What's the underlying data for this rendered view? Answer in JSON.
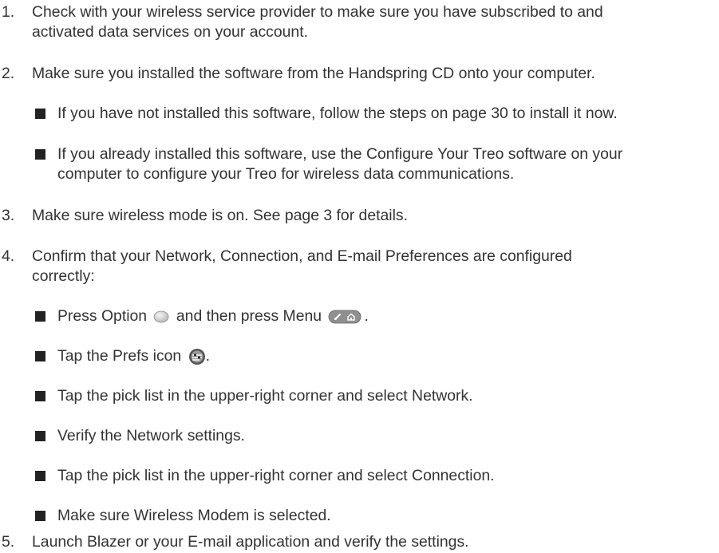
{
  "items": [
    {
      "num": "1.",
      "lines": [
        "Check with your wireless service provider to make sure you have subscribed to and",
        "activated data services on your account."
      ]
    },
    {
      "num": "2.",
      "lines": [
        "Make sure you installed the software from the Handspring CD onto your computer."
      ]
    },
    {
      "bullet": true,
      "lines": [
        "If you have not installed this software, follow the steps on page 30 to install it now."
      ]
    },
    {
      "bullet": true,
      "lines": [
        "If you already installed this software, use the Configure Your Treo software on your",
        "computer to configure your Treo for wireless data communications."
      ]
    },
    {
      "num": "3.",
      "lines": [
        "Make sure wireless mode is on. See page 3 for details."
      ]
    },
    {
      "num": "4.",
      "lines": [
        "Confirm that your Network, Connection, and E-mail Preferences are configured",
        "correctly:"
      ]
    },
    {
      "bullet": true,
      "parts": [
        "Press Option",
        "and then press Menu",
        "."
      ]
    },
    {
      "bullet": true,
      "parts": [
        "Tap the Prefs icon",
        "."
      ]
    },
    {
      "bullet": true,
      "lines": [
        "Tap the pick list in the upper-right corner and select Network."
      ]
    },
    {
      "bullet": true,
      "lines": [
        "Verify the Network settings."
      ]
    },
    {
      "bullet": true,
      "lines": [
        "Tap the pick list in the upper-right corner and select Connection."
      ]
    },
    {
      "bullet": true,
      "lines": [
        "Make sure Wireless Modem is selected."
      ]
    },
    {
      "num": "5.",
      "lines": [
        "Launch Blazer or your E-mail application and verify the settings."
      ]
    }
  ],
  "icons": {
    "option_key": "option-key-icon",
    "menu_key": "menu-key-icon",
    "prefs": "prefs-icon"
  }
}
